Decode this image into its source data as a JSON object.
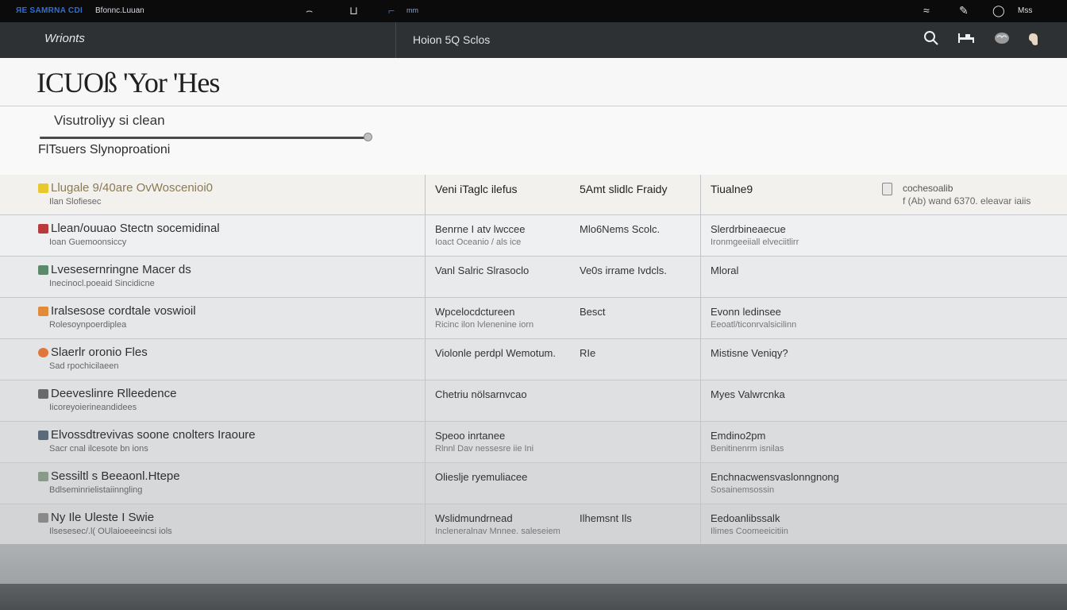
{
  "system_bar": {
    "brand": "ЯE SAMRNA CDI",
    "brand2": "Bfonnc.Luuan",
    "center_label": "mm",
    "tray_label": "Мss"
  },
  "app": {
    "logo": "Wrionts",
    "subtitle": "Hoion 5Q Sclos",
    "icons": [
      "search-icon",
      "bed-icon",
      "brain-icon",
      "hand-icon"
    ]
  },
  "page": {
    "title": "ICUOß 'Yor  'Hes"
  },
  "filter": {
    "label": "Visutroliyy si clean",
    "slider_value": 1.0,
    "sublabel": "FlTsuers Slynoproationi"
  },
  "table": {
    "header": {
      "col1_main": "Llugale 9/40are OvWoscenioi0",
      "col1_sub": "Ilan Slofiesec",
      "col2_a": "Veni iTaglc ilefus",
      "col2_b": "5Amt slidlc Fraidy",
      "col3_a": "Tiualne9",
      "col3_extra1": "cochesoalib",
      "col3_extra2": "f (Ab) wand 6370. eleavar iaiis"
    },
    "rows": [
      {
        "icon_color": "#b83a3a",
        "main": "Llean/ouuao Stectn socemidinal",
        "sub": "Ioan Guemoonsiccy",
        "col2_a": "Benrne I atv lwccee",
        "col2_a_sub": "Ioact Oceanio / als ice",
        "col2_b": "Mlo6Nems Scolc.",
        "col3": "Slerdrbineaecue",
        "col3_sub": "Ironmgeeiiall elveciitlirr"
      },
      {
        "icon_color": "#5a8a6a",
        "main": "Lvesesernringne Macer ds",
        "sub": "Inecinocl.poeaid Sincidicne",
        "col2_a": "Vanl Salric Slrasoclo",
        "col2_a_sub": "",
        "col2_b": "Ve0s irrame Ivdcls.",
        "col3": "Mloral",
        "col3_sub": ""
      },
      {
        "icon_color": "#e08a3a",
        "main": "Iralsesose cordtale voswioil",
        "sub": "Rolesoynpoerdiplea",
        "col2_a": "Wpcelocdctureen",
        "col2_a_sub": "Ricinc ilon lvlenenine iorn",
        "col2_b": "Besct",
        "col3": "Evonn ledinsee",
        "col3_sub": "Eeoatl/ticonrvalsicilinn"
      },
      {
        "icon_color": "#e0763a",
        "icon_round": true,
        "main": "Slaerlr oronio Fles",
        "sub": "Sad rpochicilaeen",
        "col2_a": "Violonle perdpl Wemotum.",
        "col2_a_sub": "",
        "col2_b": "RIe",
        "col3": "Mistisne Veniqy?",
        "col3_sub": ""
      },
      {
        "icon_color": "#6a6a6a",
        "main": "Deeveslinre Rlleedence",
        "sub": "Iicoreyoierineandidees",
        "col2_a": "Chetriu nölsarnvcao",
        "col2_a_sub": "",
        "col2_b": "",
        "col3": "Myes Valwrcnka",
        "col3_sub": ""
      },
      {
        "icon_color": "#5a6a7a",
        "main": "Elvossdtrevivas soone cnolters Iraoure",
        "sub": "Sacr cnal ilcesote bn ions",
        "col2_a": "Speoo inrtanee",
        "col2_a_sub": "Rlnnl Dav nessesre iie Ini",
        "col2_b": "",
        "col3": "Emdino2pm",
        "col3_sub": "Benitinenrm isnilas"
      },
      {
        "icon_color": "#8a9a8a",
        "main": "Sessiltl s Beeaonl.Htepe",
        "sub": "Bdlseminrielistaiinngling",
        "col2_a": "Olieslje ryemuliacee",
        "col2_a_sub": "",
        "col2_b": "",
        "col3": "Enchnacwensvaslonngnong",
        "col3_sub": "Sosainemsossin"
      },
      {
        "icon_color": "#8a8a8a",
        "main": "Ny  Ile  Uleste I Swie",
        "sub": "Ilsesesec/.l( OUlaioeeeincsi iols",
        "col2_a": "Wslidmundrnead",
        "col2_a_sub": "Incleneralnav Mnnee. saleseiem",
        "col2_b": "Ilhemsnt Ils",
        "col3": "Eedoanlibssalk",
        "col3_sub": "Ilimes Coomeeicitiin"
      }
    ]
  }
}
